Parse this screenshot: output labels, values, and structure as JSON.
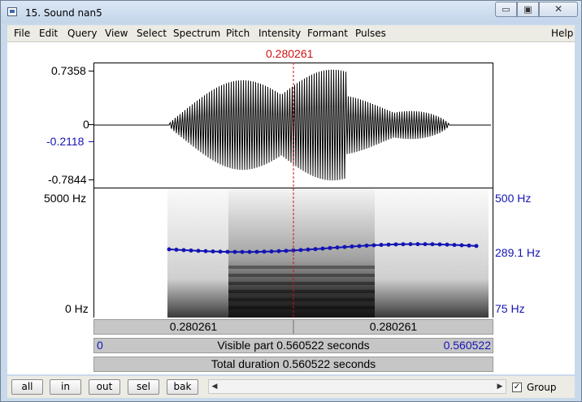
{
  "window": {
    "title": "15. Sound nan5",
    "minimize_glyph": "▭",
    "maximize_glyph": "▣",
    "close_glyph": "✕",
    "icon": "praat-window-icon"
  },
  "menu": [
    "File",
    "Edit",
    "Query",
    "View",
    "Select",
    "Spectrum",
    "Pitch",
    "Intensity",
    "Formant",
    "Pulses",
    "Help"
  ],
  "cursor": {
    "time_label": "0.280261",
    "fraction": 0.5
  },
  "waveform": {
    "max_label": "0.7358",
    "zero_label": "0",
    "cursor_value_label": "-0.2118",
    "min_label": "-0.7844"
  },
  "spectrogram": {
    "top_left_label": "5000 Hz",
    "bottom_left_label": "0 Hz",
    "pitch_top_label": "500 Hz",
    "pitch_cursor_label": "289.1 Hz",
    "pitch_bottom_label": "75 Hz"
  },
  "panels": {
    "left_time": "0.280261",
    "right_time": "0.280261",
    "visible_start": "0",
    "visible_part": "Visible part 0.560522 seconds",
    "visible_end": "0.560522",
    "total_duration": "Total duration 0.560522 seconds"
  },
  "bottom_buttons": [
    "all",
    "in",
    "out",
    "sel",
    "bak"
  ],
  "group": {
    "label": "Group",
    "checked": true,
    "check_glyph": "✓"
  },
  "scroll": {
    "left_arrow": "◀",
    "right_arrow": "▶"
  },
  "colors": {
    "cursor": "#d01010",
    "pitch": "#1414b4",
    "waveform": "#000000"
  }
}
